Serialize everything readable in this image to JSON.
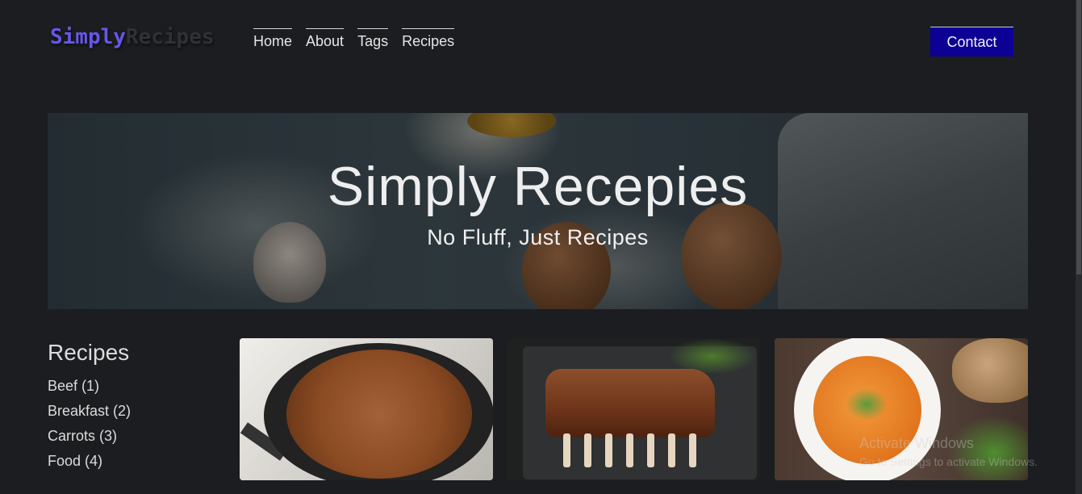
{
  "header": {
    "logo_part1": "Simply",
    "logo_part2": "Recipes",
    "nav": [
      "Home",
      "About",
      "Tags",
      "Recipes"
    ],
    "contact_label": "Contact"
  },
  "hero": {
    "title": "Simply Recepies",
    "subtitle": "No Fluff, Just Recipes"
  },
  "sidebar": {
    "title": "Recipes",
    "tags": [
      "Beef (1)",
      "Breakfast (2)",
      "Carrots (3)",
      "Food (4)"
    ]
  },
  "cards": [
    {
      "icon": "pan-fried-ground-meat-image"
    },
    {
      "icon": "rack-of-ribs-image"
    },
    {
      "icon": "tomato-soup-bowl-image"
    }
  ],
  "watermark": {
    "line1": "Activate Windows",
    "line2": "Go to Settings to activate Windows."
  },
  "colors": {
    "background": "#1c1d20",
    "logo_accent": "#6657e8",
    "contact_button": "#0c0095"
  }
}
